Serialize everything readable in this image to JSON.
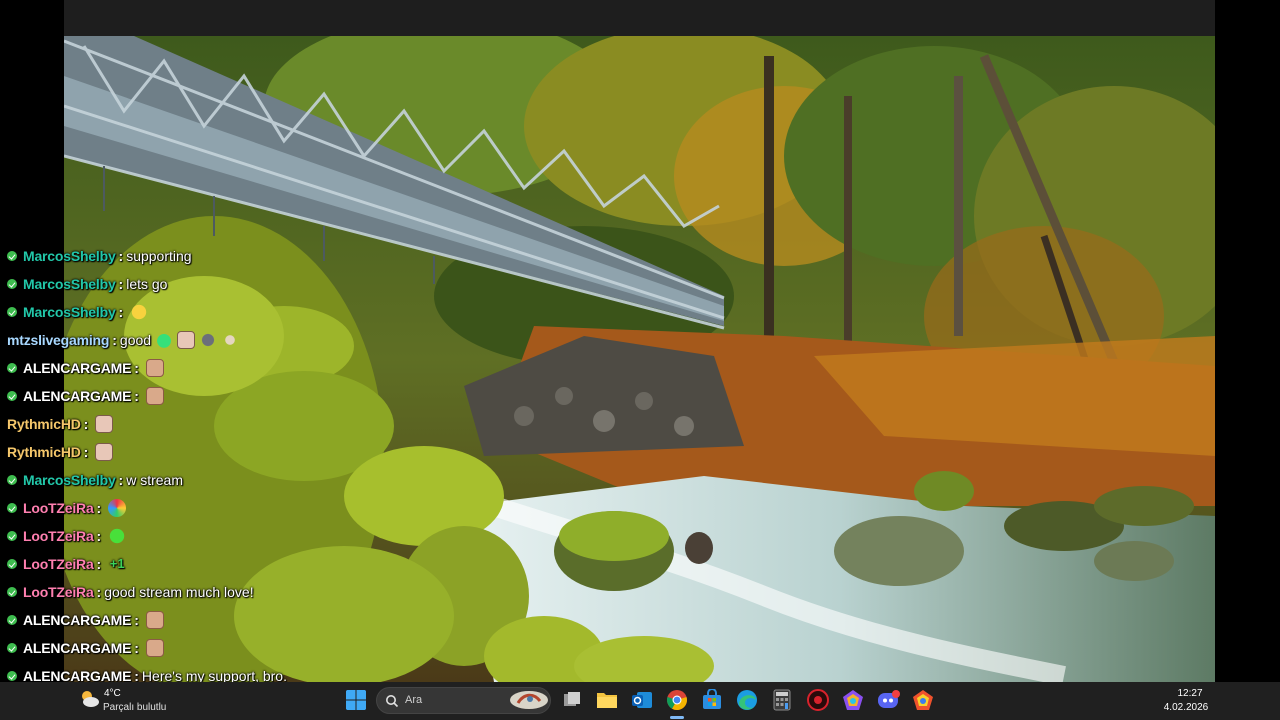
{
  "chat": {
    "messages": [
      {
        "user": "MarcosShelby",
        "color": "#22c7a9",
        "badge": true,
        "text": "supporting",
        "emotes": []
      },
      {
        "user": "MarcosShelby",
        "color": "#22c7a9",
        "badge": true,
        "text": "lets go",
        "emotes": []
      },
      {
        "user": "MarcosShelby",
        "color": "#22c7a9",
        "badge": true,
        "text": "",
        "emotes": [
          "yellow-face-emote"
        ]
      },
      {
        "user": "mtzslivegaming",
        "color": "#a8d8ff",
        "badge": false,
        "text": "good",
        "emotes": [
          "green-heart-emote",
          "girl-face-emote",
          "bat-emote",
          "hand-emote"
        ]
      },
      {
        "user": "ALENCARGAME",
        "color": "#ffffff",
        "badge": true,
        "text": "",
        "emotes": [
          "face-emote"
        ]
      },
      {
        "user": "ALENCARGAME",
        "color": "#ffffff",
        "badge": true,
        "text": "",
        "emotes": [
          "face-emote"
        ]
      },
      {
        "user": "RythmicHD",
        "color": "#f5c76b",
        "badge": false,
        "text": "",
        "emotes": [
          "girl-face-emote"
        ]
      },
      {
        "user": "RythmicHD",
        "color": "#f5c76b",
        "badge": false,
        "text": "",
        "emotes": [
          "girl-face-emote"
        ]
      },
      {
        "user": "MarcosShelby",
        "color": "#22c7a9",
        "badge": true,
        "text": "w stream",
        "emotes": []
      },
      {
        "user": "LooTZeiRa",
        "color": "#ff7fb0",
        "badge": true,
        "text": "",
        "emotes": [
          "colorful-orb-emote"
        ]
      },
      {
        "user": "LooTZeiRa",
        "color": "#ff7fb0",
        "badge": true,
        "text": "",
        "emotes": [
          "green-blob-emote"
        ]
      },
      {
        "user": "LooTZeiRa",
        "color": "#ff7fb0",
        "badge": true,
        "text": "",
        "emotes": [
          "plus-one-emote"
        ]
      },
      {
        "user": "LooTZeiRa",
        "color": "#ff7fb0",
        "badge": true,
        "text": "good stream much love!",
        "emotes": []
      },
      {
        "user": "ALENCARGAME",
        "color": "#ffffff",
        "badge": true,
        "text": "",
        "emotes": [
          "face-emote"
        ]
      },
      {
        "user": "ALENCARGAME",
        "color": "#ffffff",
        "badge": true,
        "text": "",
        "emotes": [
          "face-emote"
        ]
      },
      {
        "user": "ALENCARGAME",
        "color": "#ffffff",
        "badge": true,
        "text": "Here's my support, bro.",
        "emotes": []
      }
    ]
  },
  "taskbar": {
    "weather": {
      "temp": "4°C",
      "desc": "Parçalı bulutlu"
    },
    "search": {
      "placeholder": "Ara"
    },
    "apps": [
      "windows-start-icon",
      "search-icon",
      "task-view-icon",
      "file-explorer-icon",
      "outlook-icon",
      "chrome-icon",
      "microsoft-store-icon",
      "edge-icon",
      "calculator-icon",
      "red-app-icon",
      "colorful-app-icon",
      "discord-icon",
      "colorful-app-2-icon"
    ],
    "clock": {
      "time": "12:27",
      "date": "4.02.2026"
    }
  }
}
